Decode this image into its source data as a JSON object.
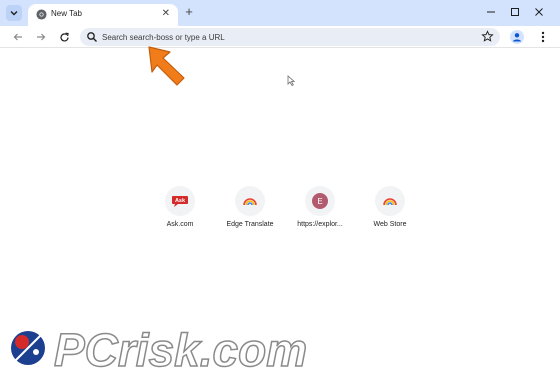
{
  "tab": {
    "title": "New Tab",
    "close_glyph": "✕"
  },
  "newtab_glyph": "+",
  "omnibox": {
    "placeholder": "Search search-boss or type a URL"
  },
  "shortcuts": [
    {
      "label": "Ask.com",
      "icon": "ask-icon",
      "badge": "Ask"
    },
    {
      "label": "Edge Translate",
      "icon": "rainbow-icon"
    },
    {
      "label": "https://explor...",
      "icon": "letter-e-icon",
      "badge": "E"
    },
    {
      "label": "Web Store",
      "icon": "rainbow-icon"
    }
  ],
  "watermark": {
    "text": "PCrisk.com"
  },
  "colors": {
    "tabstrip": "#d3e3fd",
    "omnibox": "#e9eef6",
    "arrow": "#f07d1a",
    "ask_red": "#d42a2a",
    "letter_e_bg": "#b25a6e"
  }
}
